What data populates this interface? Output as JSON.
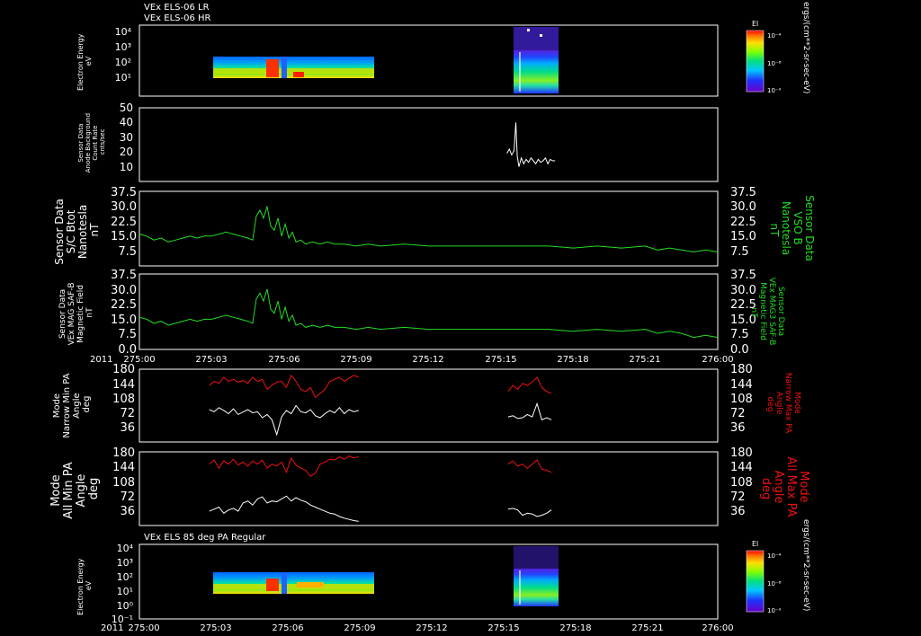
{
  "header": {
    "lines": [
      "VEx ELS-06 LR",
      "VEx ELS-06 HR"
    ]
  },
  "colors": {
    "axis": "#ffffff",
    "green": "#22dd22",
    "red": "#ee1111",
    "white": "#ffffff"
  },
  "time_axis": {
    "ticks": [
      "275:00",
      "275:03",
      "275:06",
      "275:09",
      "275:12",
      "275:15",
      "275:18",
      "275:21",
      "276:00"
    ],
    "year": "2011"
  },
  "chart_data": [
    {
      "type": "heatmap",
      "panel": "spectrogram-top",
      "ylabel": [
        "Electron Energy",
        "eV"
      ],
      "y_ticks": [
        "10⁴",
        "10³",
        "10²",
        "10¹"
      ],
      "colorbar": {
        "title": "El",
        "ticks": [
          "10⁻⁴",
          "10⁻⁸",
          "10⁻⁹"
        ],
        "unit": "ergs/(cm**2-sr-sec-eV)"
      },
      "data_blocks": [
        {
          "start": "275:02.9",
          "end": "275:09.2",
          "energy_range": [
            8,
            300
          ]
        },
        {
          "start": "275:15.3",
          "end": "275:16.9",
          "energy_range": [
            3,
            20000
          ]
        }
      ]
    },
    {
      "type": "line",
      "panel": "background",
      "ylabel": [
        "Sensor Data",
        "Anode Background",
        "Count Rate",
        "cnts/sec"
      ],
      "y_ticks": [
        "50",
        "40",
        "30",
        "20",
        "10"
      ],
      "ylim": [
        0,
        50
      ],
      "series": [
        {
          "color": "white",
          "x": [
            15.25,
            15.35,
            15.45,
            15.55,
            15.62,
            15.68,
            15.75,
            15.85,
            15.95,
            16.05,
            16.15,
            16.25,
            16.35,
            16.45,
            16.55,
            16.65,
            16.75,
            16.85,
            16.95,
            17.05,
            17.15,
            17.25
          ],
          "y": [
            19,
            22,
            18,
            21,
            40,
            17,
            10,
            16,
            12,
            15,
            13,
            16,
            14,
            12,
            15,
            13,
            14,
            16,
            12,
            15,
            14,
            14
          ]
        }
      ]
    },
    {
      "type": "line",
      "panel": "bmag-1",
      "ylabel": [
        "Sensor Data",
        "S/C Btot",
        "Nanotesla",
        "nT"
      ],
      "right_label": [
        "Sensor Data",
        "VSO B",
        "Nanotesla",
        "nT"
      ],
      "y_ticks": [
        "37.5",
        "30.0",
        "22.5",
        "15.0",
        "7.5"
      ],
      "ylim": [
        0,
        37.5
      ],
      "series": [
        {
          "color": "green",
          "x": [
            0,
            0.3,
            0.6,
            0.9,
            1.2,
            1.5,
            1.8,
            2.1,
            2.4,
            2.7,
            3.0,
            3.3,
            3.6,
            3.9,
            4.2,
            4.5,
            4.7,
            4.85,
            5.0,
            5.15,
            5.3,
            5.45,
            5.6,
            5.75,
            5.9,
            6.05,
            6.2,
            6.35,
            6.5,
            6.7,
            6.9,
            7.2,
            7.5,
            7.8,
            8.1,
            8.5,
            9.0,
            9.5,
            10.0,
            11.0,
            12.0,
            13.0,
            14.0,
            15.0,
            16.0,
            17.0,
            18.0,
            19.0,
            20.0,
            21.0,
            21.5,
            22.0,
            22.5,
            23.0,
            23.5,
            24.0
          ],
          "y": [
            16,
            15,
            13,
            14,
            12,
            13,
            14,
            15,
            14,
            15,
            15,
            16,
            17,
            16,
            15,
            14,
            13,
            25,
            28,
            24,
            30,
            20,
            18,
            24,
            15,
            21,
            14,
            17,
            12,
            13,
            11,
            12,
            11,
            12,
            11,
            11,
            10,
            11,
            10,
            11,
            10,
            10,
            10,
            10,
            10,
            10,
            9,
            10,
            9,
            10,
            8,
            9,
            8,
            7,
            8,
            7
          ]
        }
      ]
    },
    {
      "type": "line",
      "panel": "bmag-2",
      "ylabel": [
        "Sensor Data",
        "VEx MAG SAF-B",
        "Magnetic Field",
        "nT"
      ],
      "right_label": [
        "Sensor Data",
        "VEx MAG3 SAF-B",
        "Magnetic Field",
        "nT"
      ],
      "y_ticks": [
        "37.5",
        "30.0",
        "22.5",
        "15.0",
        "7.5",
        "0.0"
      ],
      "ylim": [
        0,
        37.5
      ],
      "series": [
        {
          "color": "green",
          "x": [
            0,
            0.3,
            0.6,
            0.9,
            1.2,
            1.5,
            1.8,
            2.1,
            2.4,
            2.7,
            3.0,
            3.3,
            3.6,
            3.9,
            4.2,
            4.5,
            4.7,
            4.85,
            5.0,
            5.15,
            5.3,
            5.45,
            5.6,
            5.75,
            5.9,
            6.05,
            6.2,
            6.35,
            6.5,
            6.7,
            6.9,
            7.2,
            7.5,
            7.8,
            8.1,
            8.5,
            9.0,
            9.5,
            10.0,
            11.0,
            12.0,
            13.0,
            14.0,
            15.0,
            16.0,
            17.0,
            18.0,
            19.0,
            20.0,
            21.0,
            21.5,
            22.0,
            22.5,
            23.0,
            23.5,
            24.0
          ],
          "y": [
            16,
            15,
            13,
            14,
            12,
            13,
            14,
            15,
            14,
            15,
            15,
            16,
            17,
            16,
            15,
            14,
            13,
            25,
            28,
            24,
            30,
            20,
            18,
            24,
            15,
            21,
            14,
            17,
            12,
            13,
            11,
            12,
            11,
            12,
            11,
            11,
            10,
            11,
            10,
            11,
            10,
            10,
            10,
            10,
            10,
            10,
            9,
            10,
            9,
            10,
            8,
            9,
            8,
            6,
            7,
            6
          ]
        }
      ]
    },
    {
      "type": "line",
      "panel": "pa-narrow",
      "ylabel": [
        "Mode",
        "Narrow Min PA",
        "Angle",
        "deg"
      ],
      "right_label": [
        "Mode",
        "Narrow Max PA",
        "Angle",
        "deg"
      ],
      "y_ticks": [
        "180",
        "144",
        "108",
        "72",
        "36"
      ],
      "ylim": [
        0,
        180
      ],
      "series": [
        {
          "color": "white",
          "segments": [
            {
              "x": [
                2.9,
                3.1,
                3.3,
                3.5,
                3.7,
                3.9,
                4.1,
                4.3,
                4.5,
                4.7,
                4.9,
                5.1,
                5.3,
                5.5,
                5.7,
                5.9,
                6.1,
                6.3,
                6.5,
                6.7,
                6.9,
                7.1,
                7.3,
                7.5,
                7.7,
                7.9,
                8.1,
                8.3,
                8.5,
                8.7,
                8.9,
                9.1
              ],
              "y": [
                80,
                75,
                85,
                78,
                70,
                82,
                68,
                74,
                80,
                72,
                75,
                60,
                68,
                55,
                18,
                62,
                78,
                70,
                90,
                75,
                72,
                80,
                65,
                60,
                70,
                78,
                72,
                85,
                70,
                80,
                75,
                78
              ]
            },
            {
              "x": [
                15.3,
                15.5,
                15.7,
                15.9,
                16.1,
                16.3,
                16.5,
                16.7,
                16.9,
                17.1
              ],
              "y": [
                62,
                65,
                58,
                60,
                68,
                62,
                95,
                55,
                60,
                55
              ]
            }
          ]
        },
        {
          "color": "red",
          "segments": [
            {
              "x": [
                2.9,
                3.1,
                3.3,
                3.5,
                3.7,
                3.9,
                4.1,
                4.3,
                4.5,
                4.7,
                4.9,
                5.1,
                5.3,
                5.5,
                5.7,
                5.9,
                6.1,
                6.3,
                6.5,
                6.7,
                6.9,
                7.1,
                7.3,
                7.5,
                7.7,
                7.9,
                8.1,
                8.3,
                8.5,
                8.7,
                8.9,
                9.1
              ],
              "y": [
                140,
                150,
                145,
                160,
                150,
                155,
                148,
                152,
                145,
                160,
                150,
                155,
                130,
                140,
                148,
                150,
                135,
                165,
                150,
                130,
                125,
                135,
                110,
                120,
                130,
                150,
                155,
                160,
                150,
                158,
                165,
                160
              ]
            },
            {
              "x": [
                15.3,
                15.5,
                15.7,
                15.9,
                16.1,
                16.3,
                16.5,
                16.7,
                16.9,
                17.1
              ],
              "y": [
                125,
                140,
                130,
                145,
                140,
                148,
                160,
                135,
                125,
                120
              ]
            }
          ]
        }
      ]
    },
    {
      "type": "line",
      "panel": "pa-all",
      "ylabel": [
        "Mode",
        "All Min PA",
        "Angle",
        "deg"
      ],
      "right_label": [
        "Mode",
        "All Max PA",
        "Angle",
        "deg"
      ],
      "y_ticks": [
        "180",
        "144",
        "108",
        "72",
        "36"
      ],
      "ylim": [
        0,
        180
      ],
      "series": [
        {
          "color": "white",
          "segments": [
            {
              "x": [
                2.9,
                3.1,
                3.3,
                3.5,
                3.7,
                3.9,
                4.1,
                4.3,
                4.5,
                4.7,
                4.9,
                5.1,
                5.3,
                5.5,
                5.7,
                5.9,
                6.1,
                6.3,
                6.5,
                6.7,
                6.9,
                7.1,
                7.3,
                7.5,
                7.7,
                7.9,
                8.1,
                8.3,
                8.5,
                8.7,
                8.9,
                9.1
              ],
              "y": [
                35,
                40,
                45,
                30,
                38,
                42,
                35,
                55,
                60,
                50,
                65,
                70,
                55,
                60,
                58,
                65,
                72,
                60,
                68,
                62,
                58,
                50,
                45,
                40,
                35,
                30,
                28,
                22,
                18,
                15,
                12,
                10
              ]
            },
            {
              "x": [
                15.3,
                15.5,
                15.7,
                15.9,
                16.1,
                16.3,
                16.5,
                16.7,
                16.9,
                17.1
              ],
              "y": [
                40,
                42,
                38,
                25,
                30,
                28,
                22,
                25,
                30,
                38
              ]
            }
          ]
        },
        {
          "color": "red",
          "segments": [
            {
              "x": [
                2.9,
                3.1,
                3.3,
                3.5,
                3.7,
                3.9,
                4.1,
                4.3,
                4.5,
                4.7,
                4.9,
                5.1,
                5.3,
                5.5,
                5.7,
                5.9,
                6.1,
                6.3,
                6.5,
                6.7,
                6.9,
                7.1,
                7.3,
                7.5,
                7.7,
                7.9,
                8.1,
                8.3,
                8.5,
                8.7,
                8.9,
                9.1
              ],
              "y": [
                150,
                160,
                140,
                158,
                150,
                162,
                148,
                155,
                145,
                158,
                150,
                160,
                140,
                150,
                145,
                155,
                130,
                165,
                148,
                140,
                135,
                120,
                128,
                150,
                155,
                162,
                160,
                168,
                162,
                170,
                165,
                168
              ]
            },
            {
              "x": [
                15.3,
                15.5,
                15.7,
                15.9,
                16.1,
                16.3,
                16.5,
                16.7,
                16.9,
                17.1
              ],
              "y": [
                150,
                158,
                145,
                150,
                140,
                150,
                160,
                138,
                135,
                130
              ]
            }
          ]
        }
      ]
    },
    {
      "type": "heatmap",
      "panel": "spectrogram-bottom",
      "title": "VEx ELS 85 deg PA Regular",
      "ylabel": [
        "Electron Energy",
        "eV"
      ],
      "y_ticks": [
        "10⁴",
        "10³",
        "10²",
        "10¹",
        "10⁰",
        "10⁻¹"
      ],
      "colorbar": {
        "title": "El",
        "ticks": [
          "10⁻⁴",
          "10⁻⁸",
          "10⁻⁹"
        ],
        "unit": "ergs/(cm**2-sr-sec-eV)"
      },
      "data_blocks": [
        {
          "start": "275:02.9",
          "end": "275:09.2",
          "energy_range": [
            1,
            300
          ]
        },
        {
          "start": "275:15.3",
          "end": "275:16.9",
          "energy_range": [
            1,
            20000
          ]
        }
      ]
    }
  ]
}
